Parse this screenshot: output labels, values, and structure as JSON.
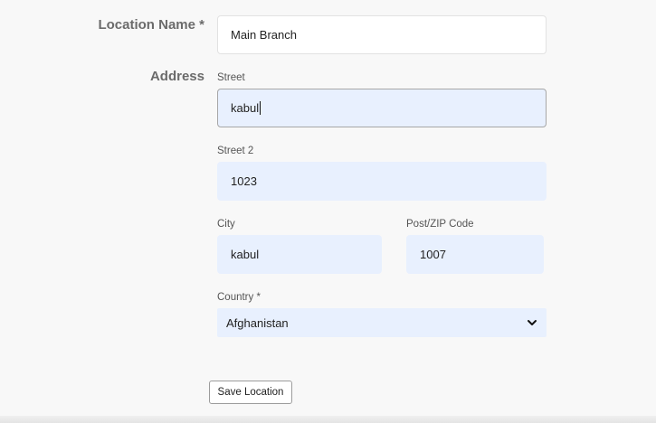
{
  "form": {
    "location_name": {
      "label": "Location Name *",
      "value": "Main Branch"
    },
    "address": {
      "label": "Address",
      "street": {
        "label": "Street",
        "value": "kabul"
      },
      "street2": {
        "label": "Street 2",
        "value": "1023"
      },
      "city": {
        "label": "City",
        "value": "kabul"
      },
      "postcode": {
        "label": "Post/ZIP Code",
        "value": "1007"
      },
      "country": {
        "label": "Country *",
        "value": "Afghanistan"
      }
    },
    "save_label": "Save Location"
  },
  "colors": {
    "autofill_bg": "#e8f0fe",
    "label_gray": "#6b6b6b",
    "page_bg": "#f8f8f8"
  },
  "icons": {
    "select_arrow": "chevron-down-icon"
  }
}
